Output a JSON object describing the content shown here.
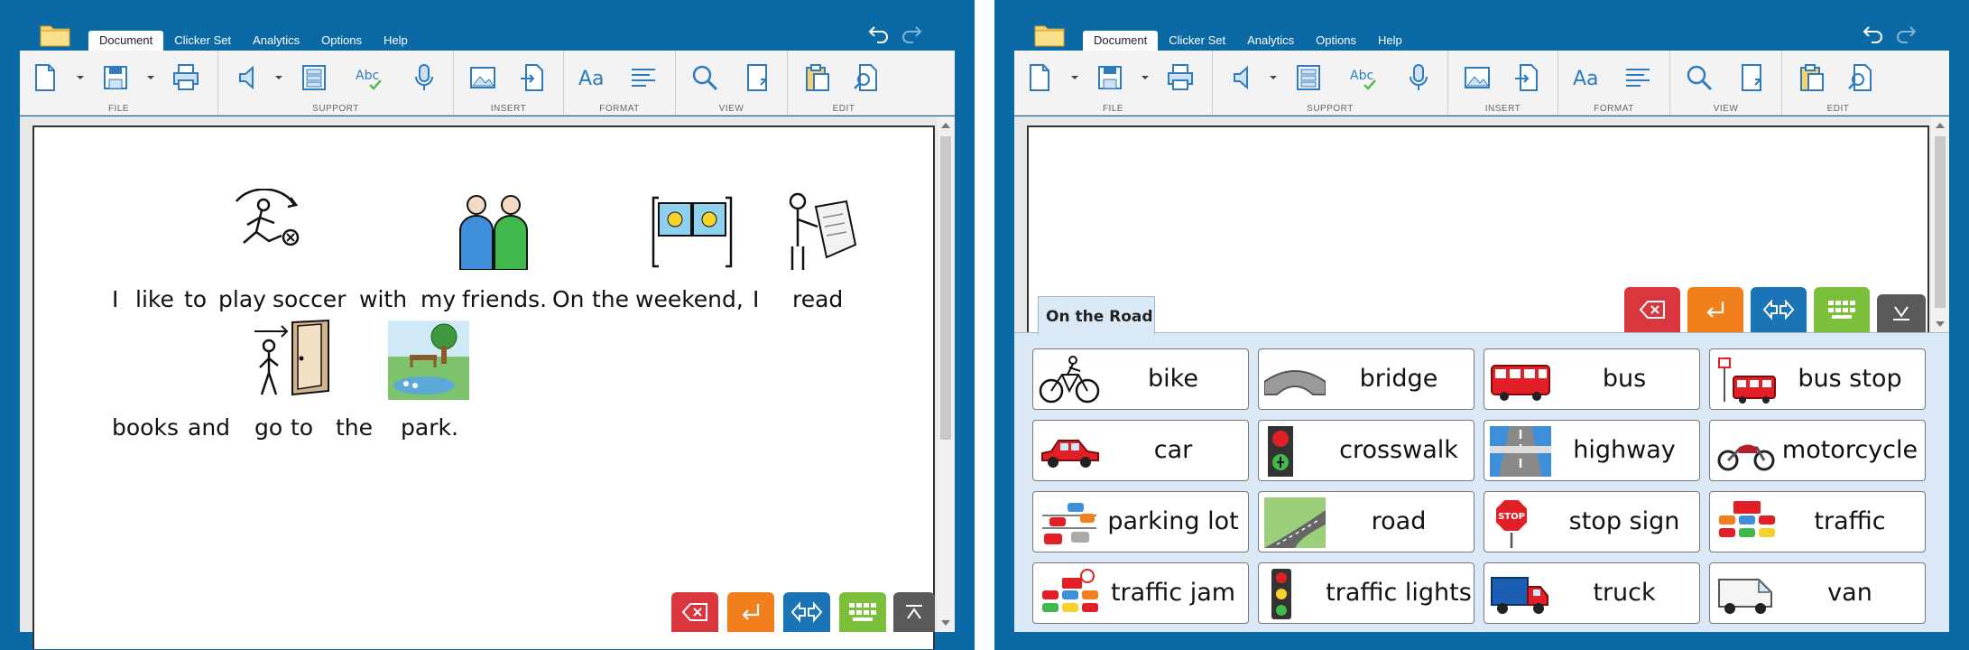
{
  "menu_tabs": [
    "Document",
    "Clicker Set",
    "Analytics",
    "Options",
    "Help"
  ],
  "ribbon_groups": [
    "FILE",
    "SUPPORT",
    "INSERT",
    "FORMAT",
    "VIEW",
    "EDIT"
  ],
  "document": {
    "line1": [
      "I",
      "like",
      "to",
      "play",
      "soccer",
      "with",
      "my",
      "friends.",
      "On",
      "the",
      "weekend,",
      "I",
      "read"
    ],
    "line2": [
      "books",
      "and",
      "go",
      "to",
      "the",
      "park."
    ]
  },
  "set": {
    "title": "On the Road",
    "cells": [
      "bike",
      "bridge",
      "bus",
      "bus stop",
      "car",
      "crosswalk",
      "highway",
      "motorcycle",
      "parking lot",
      "road",
      "stop sign",
      "traffic",
      "traffic jam",
      "traffic lights",
      "truck",
      "van"
    ]
  },
  "colors": {
    "frame": "#0b6aa6",
    "backspace": "#d9363e",
    "enter": "#f07f1c",
    "speak": "#1a74b6",
    "keyboard": "#7bbf3a",
    "collapse": "#5a5a5a",
    "panel": "#dbe9f7"
  }
}
